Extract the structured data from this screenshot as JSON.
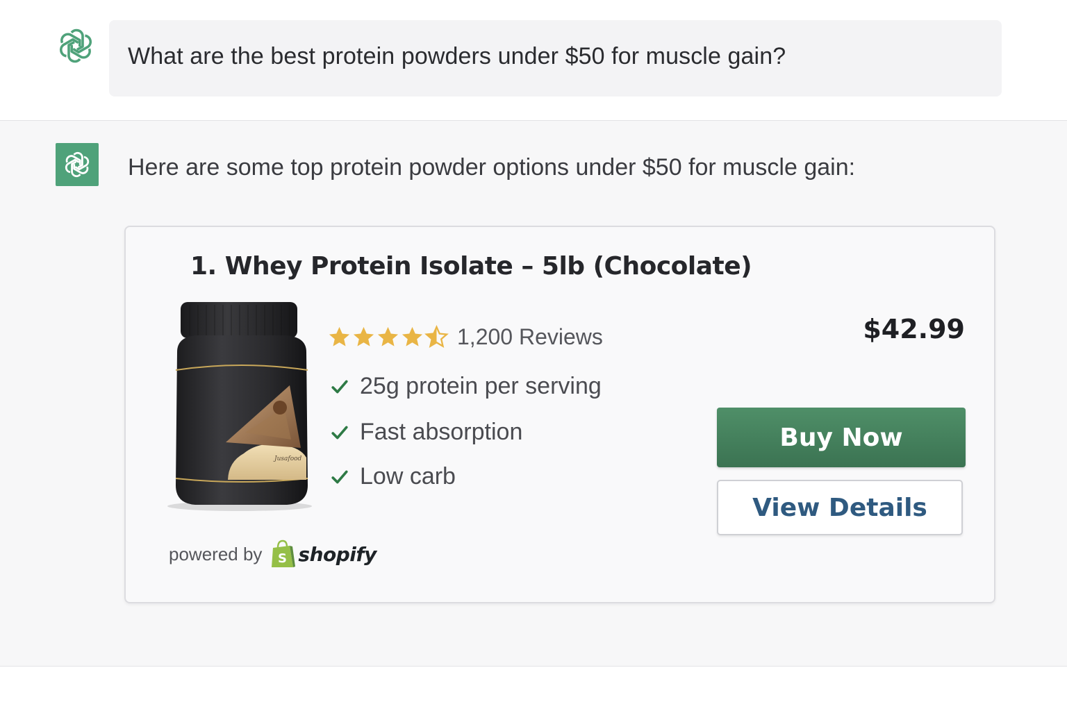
{
  "user_message": {
    "text": "What are the best protein powders under $50 for muscle gain?",
    "avatar_icon": "openai-logo-icon"
  },
  "assistant_message": {
    "text": "Here are some top protein powder options under $50 for muscle gain:",
    "avatar_icon": "openai-logo-icon",
    "avatar_color": "#4fa27a"
  },
  "product": {
    "title": "1. Whey Protein Isolate – 5lb (Chocolate)",
    "rating": 4.5,
    "rating_max": 5,
    "review_count": "1,200 Reviews",
    "features": [
      "25g protein per serving",
      "Fast absorption",
      "Low carb"
    ],
    "price": "$42.99",
    "buy_label": "Buy Now",
    "details_label": "View Details",
    "powered_by_label": "powered by",
    "powered_by_brand": "shopify",
    "star_color": "#e9b545",
    "buy_color": "#3f7a57",
    "check_color": "#2e7a45"
  }
}
